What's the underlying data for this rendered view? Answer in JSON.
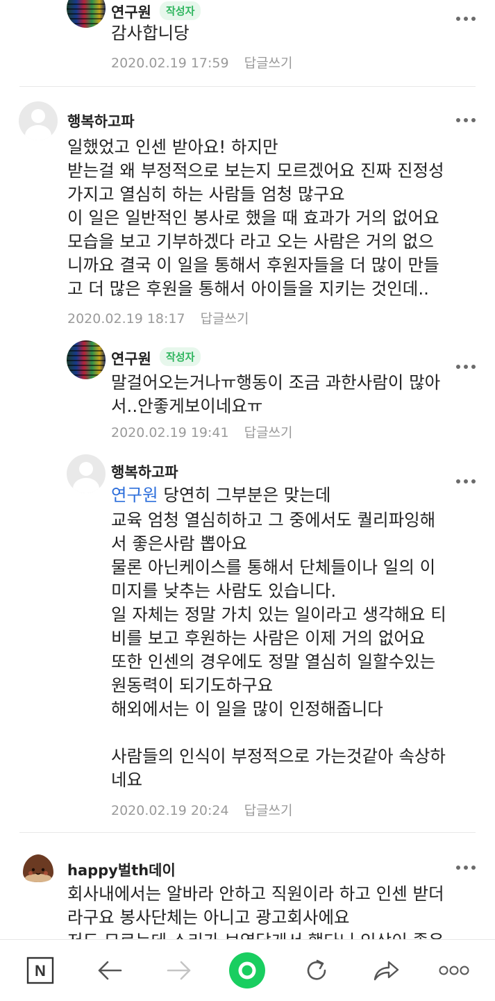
{
  "comments": [
    {
      "author": "연구원",
      "badge": "작성자",
      "text": "감사합니당",
      "date": "2020.02.19 17:59",
      "reply_label": "답글쓰기"
    },
    {
      "author": "행복하고파",
      "text": "일했었고 인센 받아요! 하지만\n받는걸 왜 부정적으로 보는지 모르겠어요 진짜 진정성\n가지고 열심히 하는 사람들 엄청 많구요\n이 일은 일반적인 봉사로 했을 때 효과가 거의 없어요\n모습을 보고 기부하겠다 라고 오는 사람은 거의 없으\n니까요 결국 이 일을 통해서 후원자들을 더 많이 만들\n고 더 많은 후원을 통해서 아이들을 지키는 것인데..",
      "date": "2020.02.19 18:17",
      "reply_label": "답글쓰기"
    },
    {
      "author": "연구원",
      "badge": "작성자",
      "text": "말걸어오는거나ㅠ행동이 조금 과한사람이 많아\n서..안좋게보이네요ㅠ",
      "date": "2020.02.19 19:41",
      "reply_label": "답글쓰기"
    },
    {
      "author": "행복하고파",
      "mention": "연구원",
      "text_first": " 당연히 그부분은 맞는데",
      "text": "교육 엄청 열심히하고 그 중에서도 퀄리파잉해\n서 좋은사람 뽑아요\n물론 아닌케이스를 통해서 단체들이나 일의 이\n미지를 낮추는 사람도 있습니다.\n일 자체는 정말 가치 있는 일이라고 생각해요 티\n비를 보고 후원하는 사람은 이제 거의 없어요\n또한 인센의 경우에도 정말 열심히 일할수있는\n원동력이 되기도하구요\n해외에서는 이 일을 많이 인정해줍니다\n\n사람들의 인식이 부정적으로 가는것같아 속상하\n네요",
      "date": "2020.02.19 20:24",
      "reply_label": "답글쓰기"
    },
    {
      "author": "happy벌th데이",
      "text": "회사내에서는 알바라 안하고 직원이라 하고 인센 받더\n라구요 봉사단체는 아니고 광고회사에요\n저도 모르는데 소리가 보였답게서 했다니 인상이 좋은"
    }
  ],
  "bottom_nav": {
    "home_letter": "N",
    "items": [
      "naver-home-icon",
      "back-arrow-icon",
      "forward-arrow-icon",
      "green-window-icon",
      "refresh-icon",
      "share-icon",
      "more-options-icon"
    ]
  },
  "colors": {
    "badge_text": "#2db55d",
    "badge_bg": "#e7f7ec",
    "mention": "#2e6fdb",
    "green_button": "#19ce60"
  }
}
